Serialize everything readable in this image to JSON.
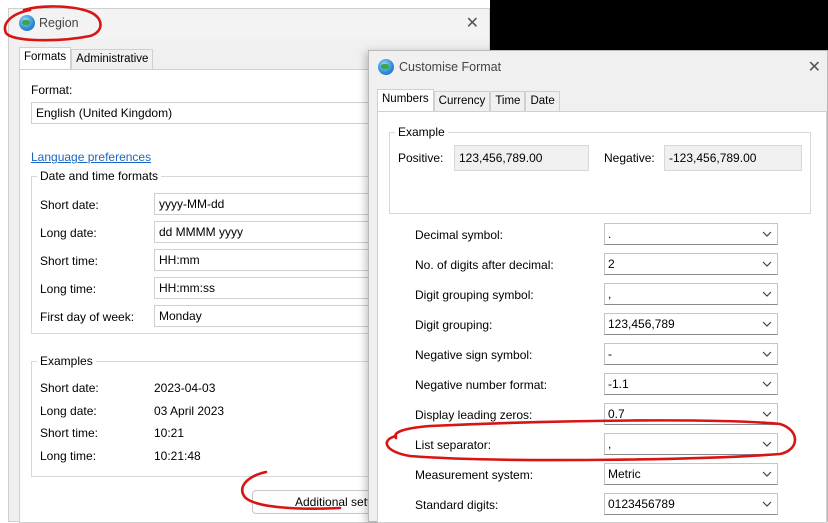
{
  "region": {
    "title": "Region",
    "tabs": [
      "Formats",
      "Administrative"
    ],
    "format_label": "Format:",
    "format_value": "English (United Kingdom)",
    "language_link": "Language preferences",
    "datetime_group": "Date and time formats",
    "fields": [
      {
        "label": "Short date:",
        "value": "yyyy-MM-dd"
      },
      {
        "label": "Long date:",
        "value": "dd MMMM yyyy"
      },
      {
        "label": "Short time:",
        "value": "HH:mm"
      },
      {
        "label": "Long time:",
        "value": "HH:mm:ss"
      },
      {
        "label": "First day of week:",
        "value": "Monday"
      }
    ],
    "examples_group": "Examples",
    "examples": [
      {
        "label": "Short date:",
        "value": "2023-04-03"
      },
      {
        "label": "Long date:",
        "value": "03 April 2023"
      },
      {
        "label": "Short time:",
        "value": "10:21"
      },
      {
        "label": "Long time:",
        "value": "10:21:48"
      }
    ],
    "additional_button": "Additional sett"
  },
  "customise": {
    "title": "Customise Format",
    "tabs": [
      "Numbers",
      "Currency",
      "Time",
      "Date"
    ],
    "example_group": "Example",
    "positive_label": "Positive:",
    "positive_value": "123,456,789.00",
    "negative_label": "Negative:",
    "negative_value": "-123,456,789.00",
    "settings": [
      {
        "label": "Decimal symbol:",
        "value": "."
      },
      {
        "label": "No. of digits after decimal:",
        "value": "2"
      },
      {
        "label": "Digit grouping symbol:",
        "value": ","
      },
      {
        "label": "Digit grouping:",
        "value": "123,456,789"
      },
      {
        "label": "Negative sign symbol:",
        "value": "-"
      },
      {
        "label": "Negative number format:",
        "value": "-1.1"
      },
      {
        "label": "Display leading zeros:",
        "value": "0.7"
      },
      {
        "label": "List separator:",
        "value": ","
      },
      {
        "label": "Measurement system:",
        "value": "Metric"
      },
      {
        "label": "Standard digits:",
        "value": "0123456789"
      }
    ]
  },
  "colors": {
    "annotation": "#d81414",
    "link": "#1a66c2"
  },
  "icons": [
    "globe-icon",
    "close-icon",
    "chevron-down-icon"
  ]
}
